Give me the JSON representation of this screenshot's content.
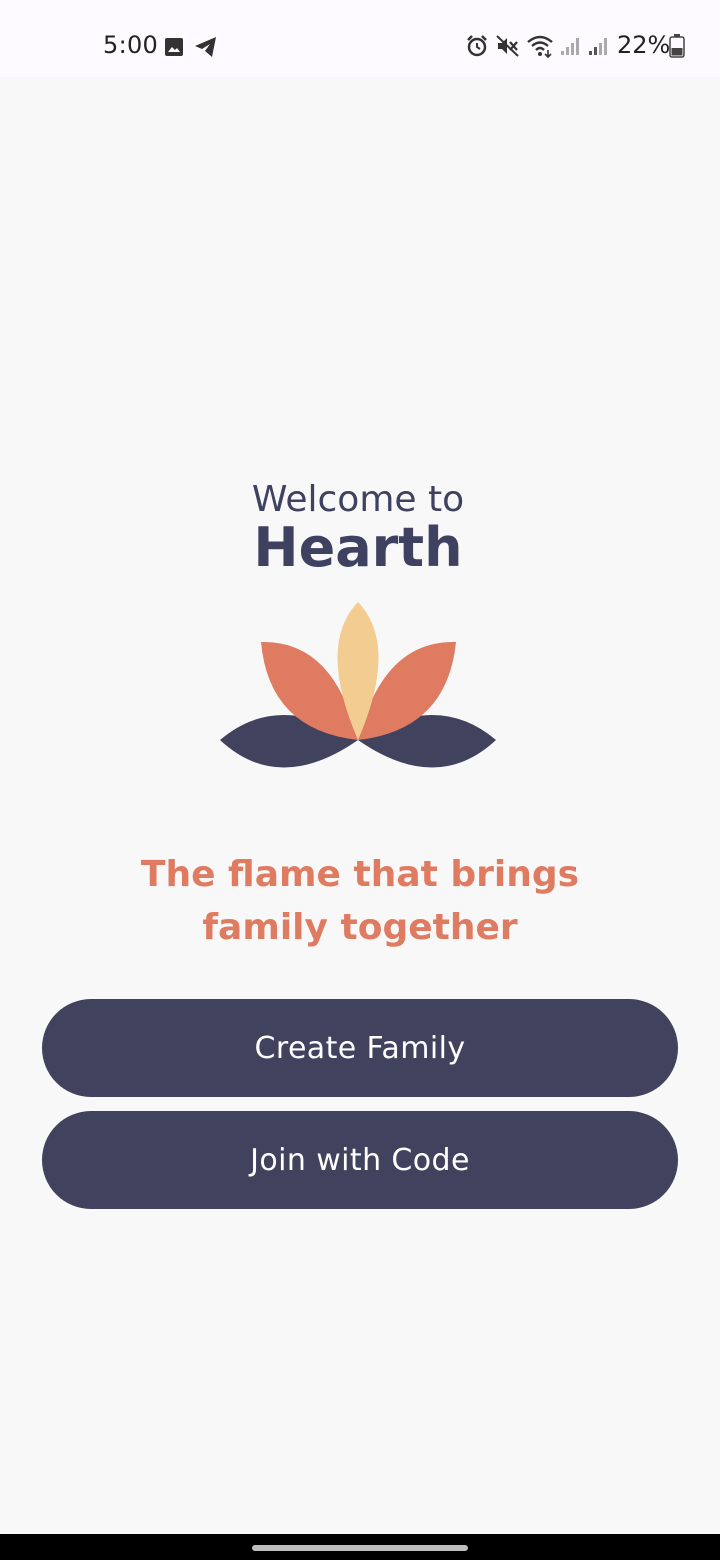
{
  "status_bar": {
    "time": "5:00",
    "battery_percent": "22%",
    "left_icons": [
      "image-icon",
      "telegram-icon"
    ],
    "right_icons": [
      "alarm-icon",
      "mute-icon",
      "wifi-icon",
      "signal-icon",
      "signal-icon",
      "battery-icon"
    ]
  },
  "welcome": {
    "line1": "Welcome to",
    "app_name": "Hearth"
  },
  "logo": {
    "icon": "lotus-flame-logo",
    "colors": {
      "dark_petal": "#40425e",
      "orange_petal": "#df7b61",
      "yellow_petal": "#f3cc91"
    }
  },
  "tagline": {
    "line1": "The flame that brings",
    "line2": "family together",
    "color": "#df7b61"
  },
  "buttons": {
    "create_label": "Create Family",
    "join_label": "Join with Code",
    "color": "#40425e"
  }
}
